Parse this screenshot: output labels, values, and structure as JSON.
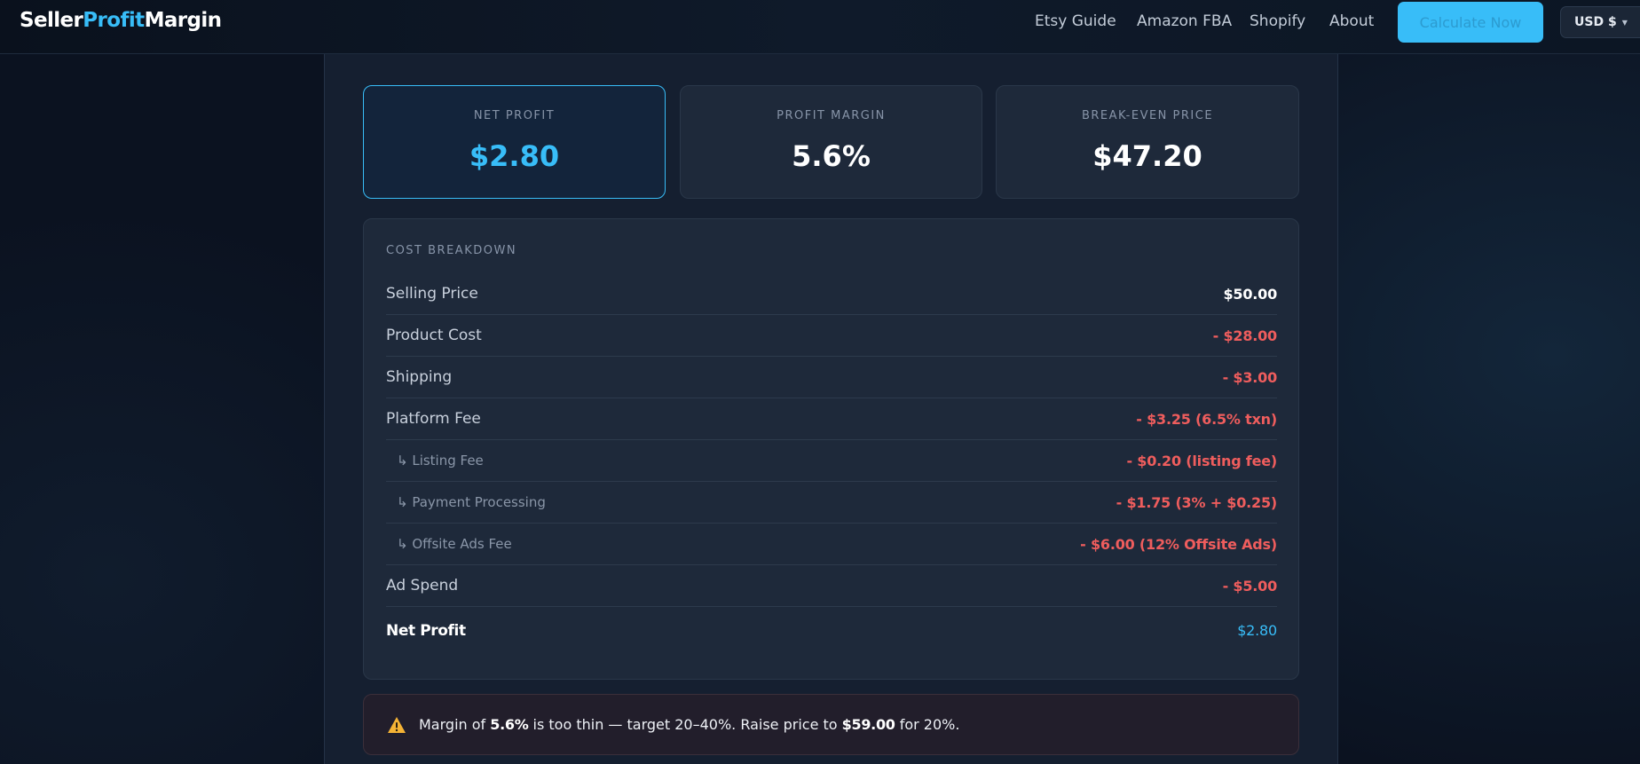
{
  "header": {
    "logo": {
      "part1": "Seller",
      "part2": "Profit",
      "part3": "Margin"
    },
    "nav": [
      {
        "label": "Etsy Guide"
      },
      {
        "label": "Amazon FBA"
      },
      {
        "label": "Shopify"
      },
      {
        "label": "About"
      }
    ],
    "cta_label": "Calculate Now",
    "currency_label": "USD $",
    "accent_color": "#38bdf8"
  },
  "stats": {
    "net_profit": {
      "label": "NET PROFIT",
      "value": "$2.80"
    },
    "profit_margin": {
      "label": "PROFIT MARGIN",
      "value": "5.6%"
    },
    "break_even": {
      "label": "BREAK-EVEN PRICE",
      "value": "$47.20"
    }
  },
  "breakdown": {
    "title": "COST BREAKDOWN",
    "rows": [
      {
        "label": "Selling Price",
        "value": "$50.00"
      },
      {
        "label": "Product Cost",
        "value": "- $28.00"
      },
      {
        "label": "Shipping",
        "value": "- $3.00"
      },
      {
        "label": "Platform Fee",
        "value": "- $3.25 (6.5% txn)"
      },
      {
        "label": "↳ Listing Fee",
        "value": "- $0.20 (listing fee)"
      },
      {
        "label": "↳ Payment Processing",
        "value": "- $1.75 (3% + $0.25)"
      },
      {
        "label": "↳ Offsite Ads Fee",
        "value": "- $6.00 (12% Offsite Ads)"
      },
      {
        "label": "Ad Spend",
        "value": "- $5.00"
      },
      {
        "label": "Net Profit",
        "value": "$2.80"
      }
    ]
  },
  "alert": {
    "icon": "warning-icon",
    "prefix": "Margin of ",
    "margin": "5.6%",
    "middle": " is too thin — target 20–40%. Raise price to ",
    "target_price": "$59.00",
    "suffix": " for 20%."
  }
}
